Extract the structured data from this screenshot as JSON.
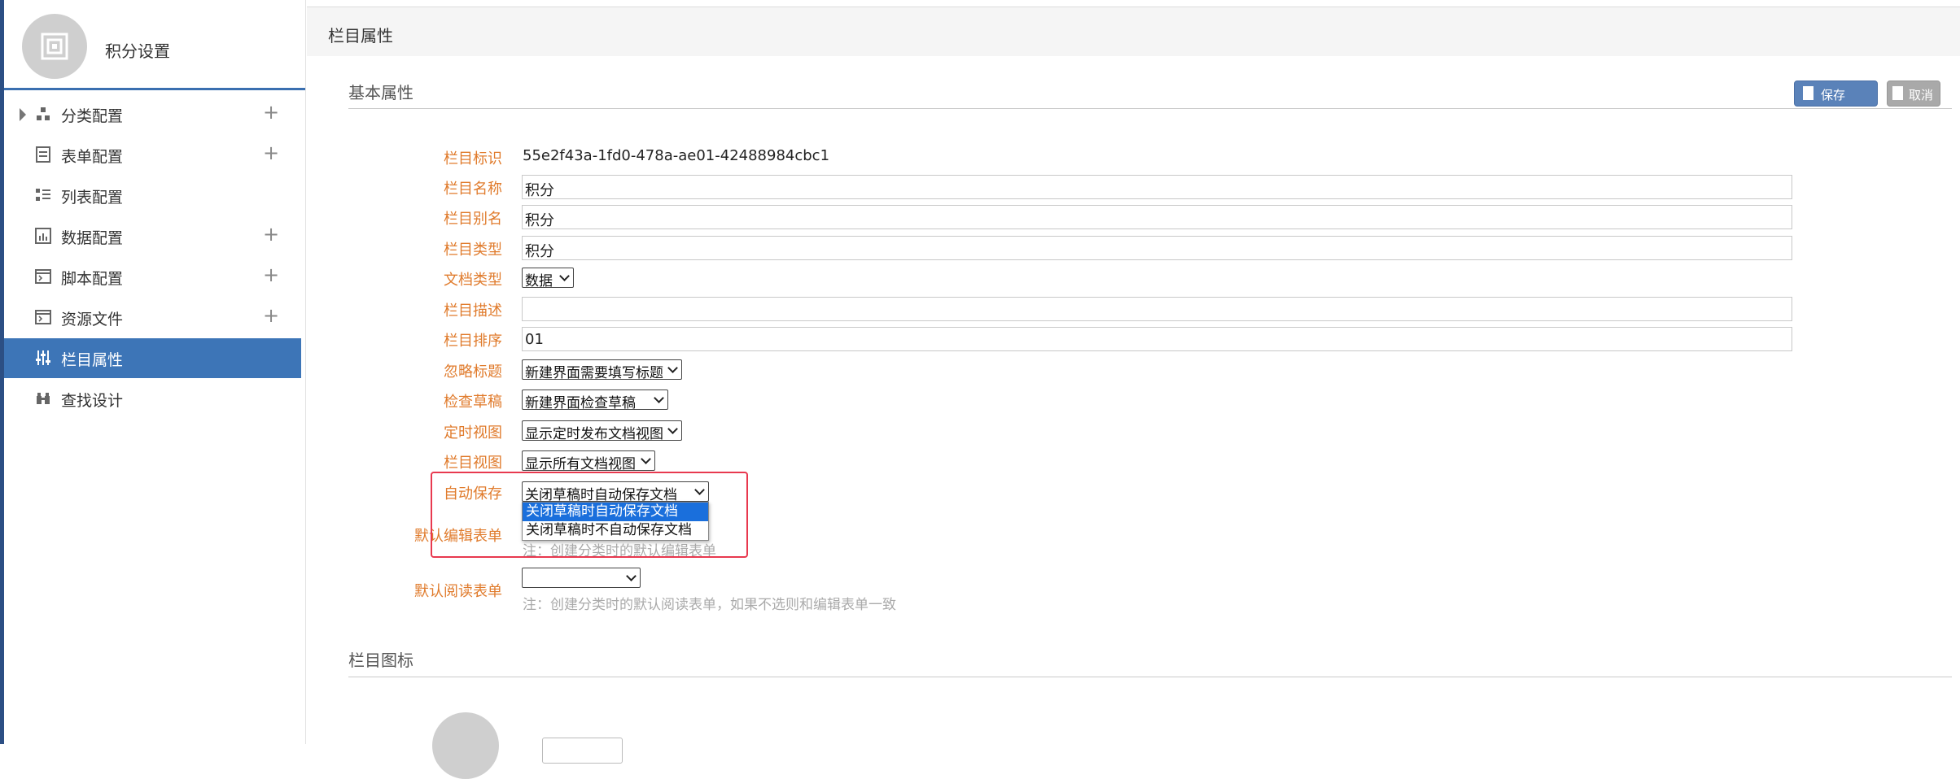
{
  "sidebar": {
    "title": "积分设置",
    "items": [
      {
        "label": "分类配置",
        "icon": "category-icon",
        "expandable": true,
        "has_add": true
      },
      {
        "label": "表单配置",
        "icon": "form-icon",
        "expandable": false,
        "has_add": true
      },
      {
        "label": "列表配置",
        "icon": "list-icon",
        "expandable": false,
        "has_add": false
      },
      {
        "label": "数据配置",
        "icon": "chart-icon",
        "expandable": false,
        "has_add": true
      },
      {
        "label": "脚本配置",
        "icon": "terminal-icon",
        "expandable": false,
        "has_add": true
      },
      {
        "label": "资源文件",
        "icon": "terminal-icon",
        "expandable": false,
        "has_add": true
      },
      {
        "label": "栏目属性",
        "icon": "sliders-icon",
        "expandable": false,
        "has_add": false,
        "active": true
      },
      {
        "label": "查找设计",
        "icon": "binoculars-icon",
        "expandable": false,
        "has_add": false
      }
    ],
    "plus_symbol": "+"
  },
  "main": {
    "title": "栏目属性",
    "basic_section": "基本属性",
    "icon_section": "栏目图标",
    "save_label": "保存",
    "cancel_label": "取消",
    "fields": {
      "id": {
        "label": "栏目标识",
        "value": "55e2f43a-1fd0-478a-ae01-42488984cbc1"
      },
      "name": {
        "label": "栏目名称",
        "value": "积分"
      },
      "alias": {
        "label": "栏目别名",
        "value": "积分"
      },
      "type": {
        "label": "栏目类型",
        "value": "积分"
      },
      "doc_type": {
        "label": "文档类型",
        "value": "数据"
      },
      "desc": {
        "label": "栏目描述",
        "value": ""
      },
      "order": {
        "label": "栏目排序",
        "value": "01"
      },
      "ignore_title": {
        "label": "忽略标题",
        "value": "新建界面需要填写标题"
      },
      "check_draft": {
        "label": "检查草稿",
        "value": "新建界面检查草稿"
      },
      "timed_view": {
        "label": "定时视图",
        "value": "显示定时发布文档视图"
      },
      "column_view": {
        "label": "栏目视图",
        "value": "显示所有文档视图"
      },
      "auto_save": {
        "label": "自动保存",
        "value": "关闭草稿时自动保存文档",
        "options": [
          "关闭草稿时自动保存文档",
          "关闭草稿时不自动保存文档"
        ],
        "highlighted_index": 0
      },
      "default_edit_form": {
        "label": "默认编辑表单",
        "value": "",
        "note": "注：创建分类时的默认编辑表单"
      },
      "default_read_form": {
        "label": "默认阅读表单",
        "value": "",
        "note": "注：创建分类时的默认阅读表单，如果不选则和编辑表单一致"
      }
    }
  },
  "colors": {
    "sidebar_active": "#3d75b7",
    "label_orange": "#e07b2c",
    "highlight_red": "#e8394f",
    "save_button": "#5a82b9"
  }
}
